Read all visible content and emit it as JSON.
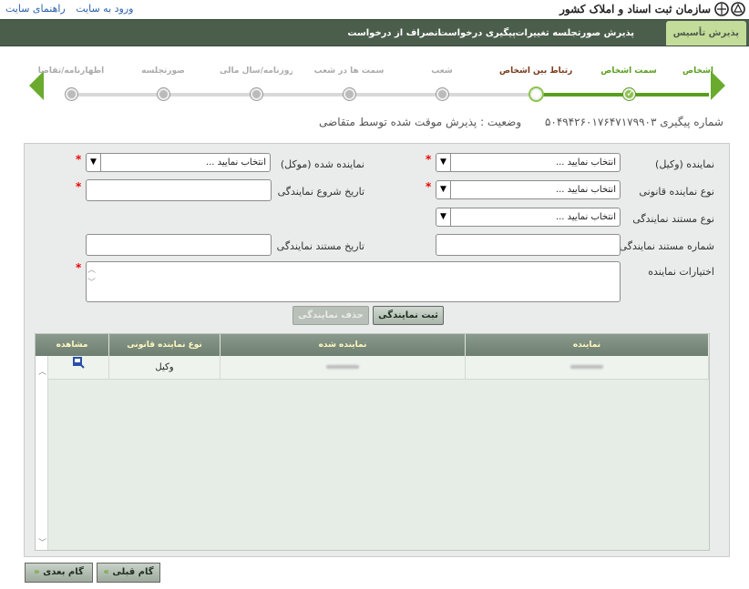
{
  "top": {
    "links": [
      "ورود به سایت",
      "راهنمای سایت"
    ],
    "logo_text": "سازمان ثبت اسناد و املاک کشور"
  },
  "nav": {
    "items": [
      {
        "label": "پذیرش تأسیس",
        "active": true
      },
      {
        "label": "پذیرش صورتجلسه تغییرات"
      },
      {
        "label": "پیگیری درخواست"
      },
      {
        "label": "انصراف از درخواست"
      }
    ]
  },
  "stepper": {
    "steps": [
      {
        "label": "اشخاص",
        "state": "done"
      },
      {
        "label": "سمت اشخاص",
        "state": "done"
      },
      {
        "label": "ارتباط بین اشخاص",
        "state": "current"
      },
      {
        "label": "شعب",
        "state": "todo"
      },
      {
        "label": "سمت ها در شعب",
        "state": "todo"
      },
      {
        "label": "روزنامه/سال مالی",
        "state": "todo"
      },
      {
        "label": "صورتجلسه",
        "state": "todo"
      },
      {
        "label": "اظهارنامه/تقاضا",
        "state": "todo"
      }
    ]
  },
  "status": {
    "tracking": "شماره پیگیری ۵۰۴۹۴۲۶۰۱۷۶۴۷۱۷۹۹۰۳",
    "state": "وضعیت : پذیرش موقت شده توسط متقاضی"
  },
  "form": {
    "agent_label": "نماینده (وکیل)",
    "agent_value": "انتخاب نمایید ...",
    "principal_label": "نماینده شده (موکل)",
    "principal_value": "انتخاب نمایید ...",
    "legal_type_label": "نوع نماینده قانونی",
    "legal_type_value": "انتخاب نمایید ...",
    "start_date_label": "تاریخ شروع نمایندگی",
    "doc_type_label": "نوع مستند نمایندگی",
    "doc_type_value": "انتخاب نمایید ...",
    "doc_number_label": "شماره مستند نمایندگی",
    "doc_date_label": "تاریخ مستند نمایندگی",
    "powers_label": "اختیارات نماینده",
    "required_mark": "*",
    "save_button": "ثبت نمایندگی",
    "delete_button": "حذف نمایندگی"
  },
  "grid": {
    "headers": [
      "نماینده",
      "نماینده شده",
      "نوع نماینده قانونی",
      "مشاهده"
    ],
    "rows": [
      {
        "legal_type": "وکیل"
      }
    ]
  },
  "footer": {
    "prev": "گام قبلی",
    "next": "گام بعدی"
  }
}
